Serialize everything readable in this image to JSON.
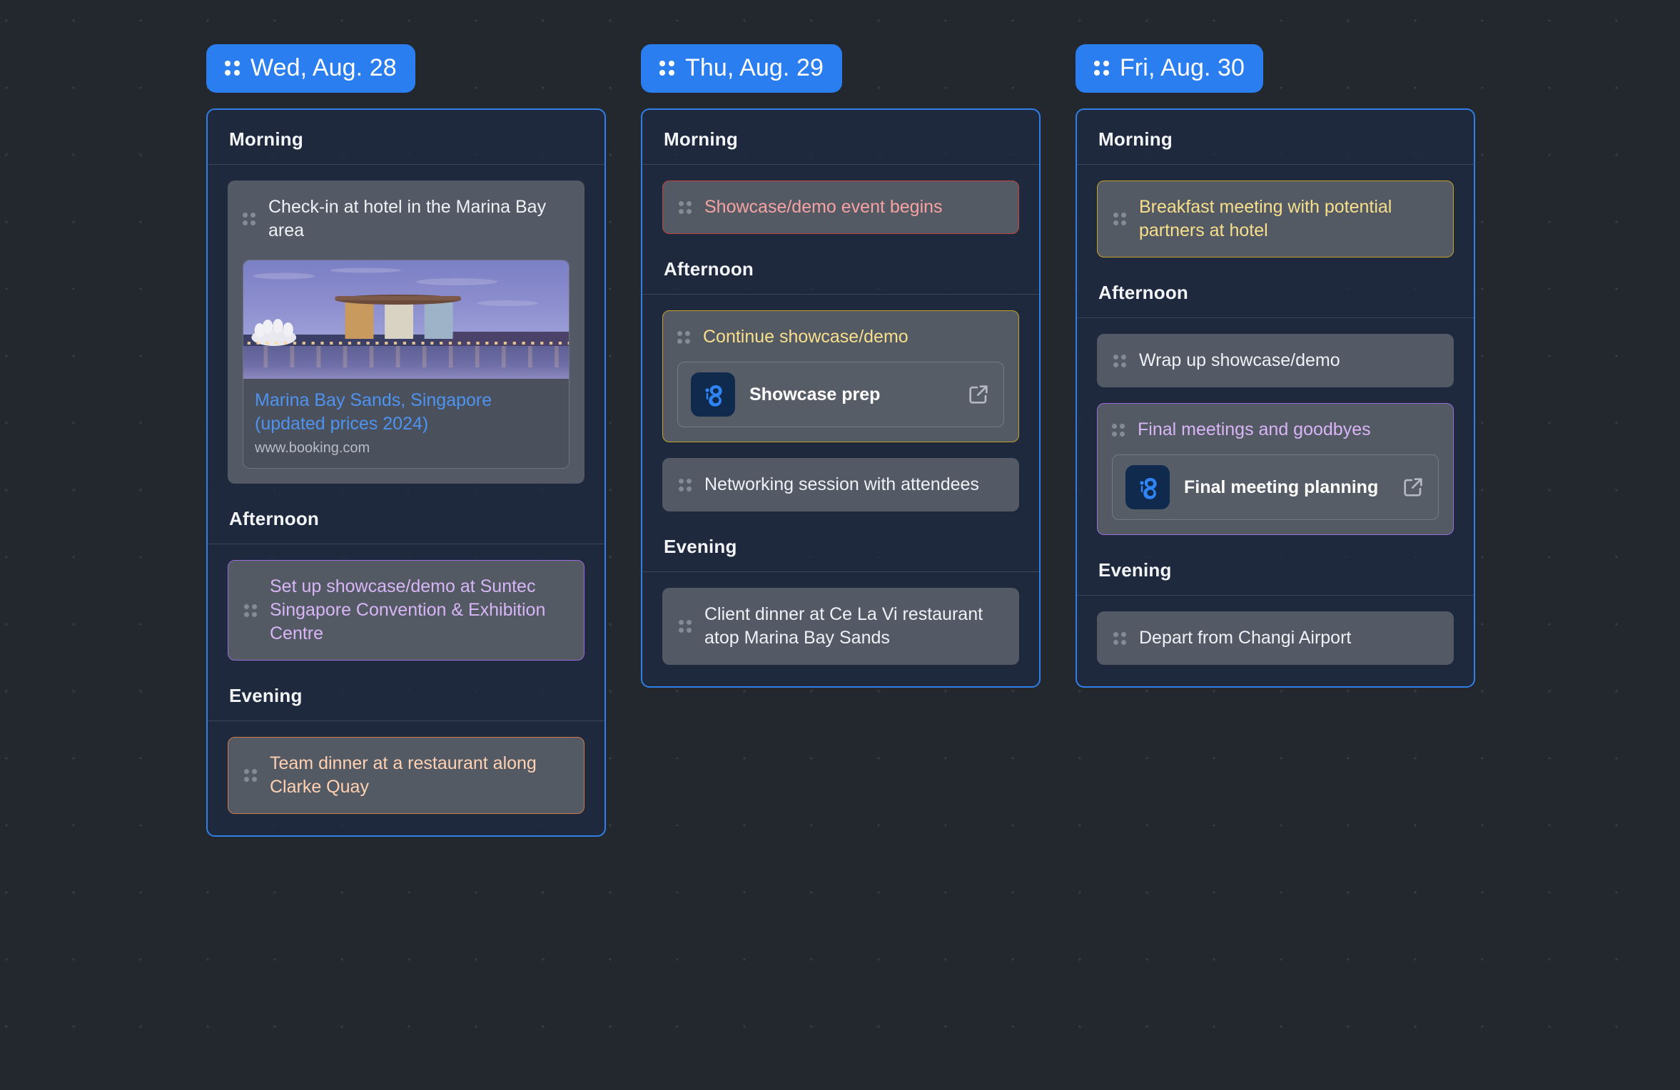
{
  "board": {
    "columns": [
      {
        "day_label": "Wed, Aug. 28",
        "drag_handle_icon": "drag-handle-icon",
        "sections": [
          {
            "title": "Morning",
            "items": [
              {
                "text": "Check-in at hotel in the Marina Bay area",
                "accent": "none",
                "preview": {
                  "image_icon": "marina-bay-sands-photo",
                  "title": "Marina Bay Sands, Singapore (updated prices 2024)",
                  "url": "www.booking.com"
                }
              }
            ]
          },
          {
            "title": "Afternoon",
            "items": [
              {
                "text": "Set up showcase/demo at Suntec Singapore Convention & Exhibition Centre",
                "accent": "purple"
              }
            ]
          },
          {
            "title": "Evening",
            "items": [
              {
                "text": "Team dinner at a restaurant along Clarke Quay",
                "accent": "orange"
              }
            ]
          }
        ]
      },
      {
        "day_label": "Thu, Aug. 29",
        "drag_handle_icon": "drag-handle-icon",
        "sections": [
          {
            "title": "Morning",
            "items": [
              {
                "text": "Showcase/demo event begins",
                "accent": "red"
              }
            ]
          },
          {
            "title": "Afternoon",
            "items": [
              {
                "text": "Continue showcase/demo",
                "accent": "yellow",
                "attachment": {
                  "label": "Showcase prep",
                  "app_icon": "app-logo-icon",
                  "open_icon": "external-link-icon"
                }
              },
              {
                "text": "Networking session with attendees",
                "accent": "none"
              }
            ]
          },
          {
            "title": "Evening",
            "items": [
              {
                "text": "Client dinner at Ce La Vi restaurant atop Marina Bay Sands",
                "accent": "none"
              }
            ]
          }
        ]
      },
      {
        "day_label": "Fri, Aug. 30",
        "drag_handle_icon": "drag-handle-icon",
        "sections": [
          {
            "title": "Morning",
            "items": [
              {
                "text": "Breakfast meeting with potential partners at hotel",
                "accent": "yellow"
              }
            ]
          },
          {
            "title": "Afternoon",
            "items": [
              {
                "text": "Wrap up showcase/demo",
                "accent": "none"
              },
              {
                "text": "Final meetings and goodbyes",
                "accent": "purple",
                "attachment": {
                  "label": "Final meeting planning",
                  "app_icon": "app-logo-icon",
                  "open_icon": "external-link-icon"
                }
              }
            ]
          },
          {
            "title": "Evening",
            "items": [
              {
                "text": "Depart from Changi Airport",
                "accent": "none"
              }
            ]
          }
        ]
      }
    ]
  },
  "colors": {
    "background": "#23272e",
    "accent_blue": "#2b7ef0",
    "card_border": "#2f7fe6",
    "task_bg": "#535a65",
    "accent_purple": "#9a6ad8",
    "accent_orange": "#cd7a4d",
    "accent_red": "#c04540",
    "accent_yellow": "#c6a12a",
    "link_blue": "#4e93f0"
  }
}
